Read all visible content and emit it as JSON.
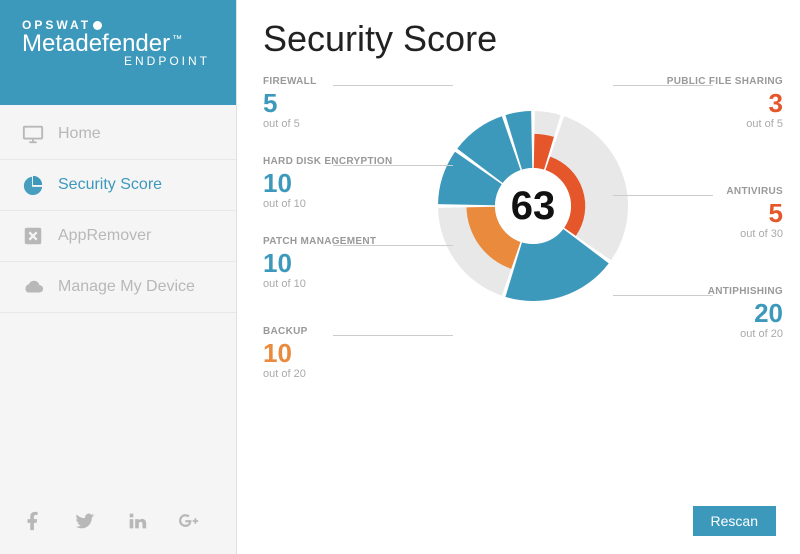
{
  "brand": {
    "line1": "OPSWAT",
    "line2": "Metadefender",
    "line3": "ENDPOINT"
  },
  "sidebar": {
    "items": [
      {
        "label": "Home"
      },
      {
        "label": "Security Score"
      },
      {
        "label": "AppRemover"
      },
      {
        "label": "Manage My Device"
      }
    ]
  },
  "page": {
    "title": "Security Score",
    "rescan_label": "Rescan"
  },
  "chart_data": {
    "type": "pie",
    "title": "Security Score",
    "center_value": 63,
    "series": [
      {
        "name": "FIREWALL",
        "value": 5,
        "max": 5,
        "status_color": "#3d99bc",
        "side": "left"
      },
      {
        "name": "HARD DISK ENCRYPTION",
        "value": 10,
        "max": 10,
        "status_color": "#3d99bc",
        "side": "left"
      },
      {
        "name": "PATCH MANAGEMENT",
        "value": 10,
        "max": 10,
        "status_color": "#3d99bc",
        "side": "left"
      },
      {
        "name": "BACKUP",
        "value": 10,
        "max": 20,
        "status_color": "#e98a3d",
        "side": "left"
      },
      {
        "name": "PUBLIC FILE SHARING",
        "value": 3,
        "max": 5,
        "status_color": "#e5562a",
        "side": "right"
      },
      {
        "name": "ANTIVIRUS",
        "value": 5,
        "max": 30,
        "status_color": "#e5562a",
        "side": "right"
      },
      {
        "name": "ANTIPHISHING",
        "value": 20,
        "max": 20,
        "status_color": "#3d99bc",
        "side": "right"
      }
    ],
    "out_of_prefix": "out of "
  }
}
